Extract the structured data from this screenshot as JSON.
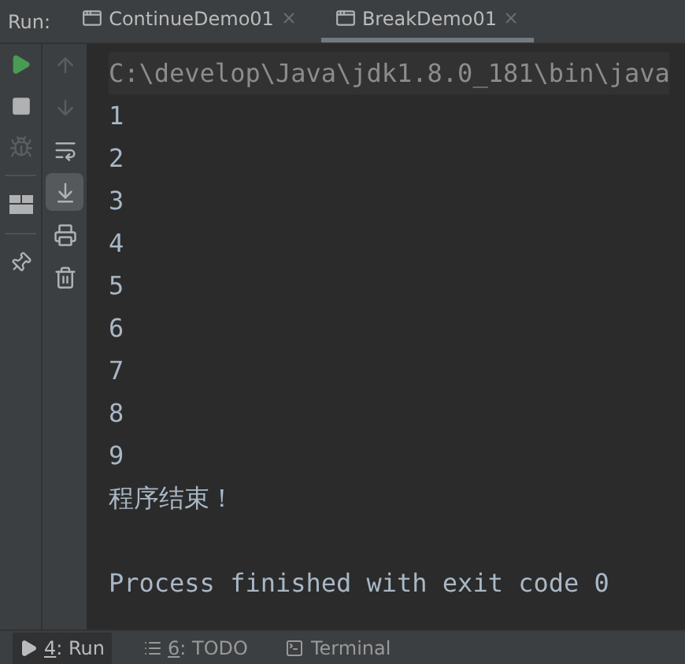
{
  "run_bar": {
    "label": "Run:",
    "tabs": [
      {
        "label": "ContinueDemo01",
        "selected": false
      },
      {
        "label": "BreakDemo01",
        "selected": true
      }
    ]
  },
  "left_toolbar": [
    {
      "kind": "run",
      "disabled": false
    },
    {
      "kind": "stop",
      "disabled": false
    },
    {
      "kind": "debug",
      "disabled": true
    },
    {
      "kind": "separator"
    },
    {
      "kind": "layout",
      "disabled": false
    },
    {
      "kind": "separator"
    },
    {
      "kind": "pin",
      "disabled": false
    }
  ],
  "console_toolbar": [
    {
      "kind": "up",
      "disabled": true,
      "on": false
    },
    {
      "kind": "down",
      "disabled": true,
      "on": false
    },
    {
      "kind": "wrap",
      "disabled": false,
      "on": false
    },
    {
      "kind": "scroll-end",
      "disabled": false,
      "on": true
    },
    {
      "kind": "print",
      "disabled": false,
      "on": false
    },
    {
      "kind": "trash",
      "disabled": false,
      "on": false
    }
  ],
  "console": {
    "command": "C:\\develop\\Java\\jdk1.8.0_181\\bin\\java",
    "lines": [
      {
        "kind": "text",
        "text": "1"
      },
      {
        "kind": "text",
        "text": "2"
      },
      {
        "kind": "text",
        "text": "3"
      },
      {
        "kind": "text",
        "text": "4"
      },
      {
        "kind": "text",
        "text": "5"
      },
      {
        "kind": "text",
        "text": "6"
      },
      {
        "kind": "text",
        "text": "7"
      },
      {
        "kind": "text",
        "text": "8"
      },
      {
        "kind": "text",
        "text": "9"
      },
      {
        "kind": "text",
        "text": "程序结束！"
      },
      {
        "kind": "blank"
      },
      {
        "kind": "text",
        "text": "Process finished with exit code 0"
      }
    ]
  },
  "bottom_tabs": [
    {
      "kind": "run",
      "mnemonic": "4",
      "label": ": Run",
      "selected": true
    },
    {
      "kind": "todo",
      "mnemonic": "6",
      "label": ": TODO",
      "selected": false
    },
    {
      "kind": "terminal",
      "label": "Terminal",
      "selected": false
    }
  ]
}
